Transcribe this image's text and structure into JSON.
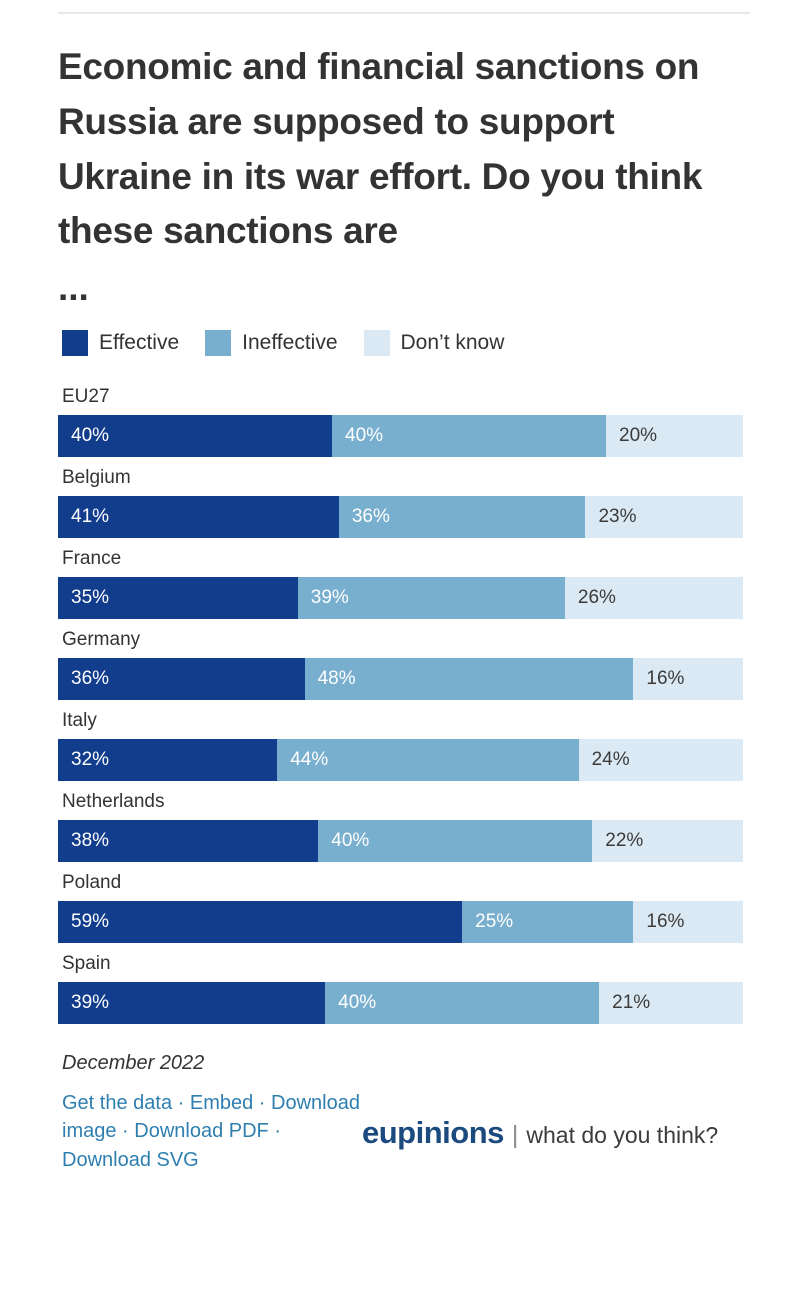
{
  "chart_data": {
    "type": "bar",
    "subtype": "stacked-horizontal-100",
    "title": "Economic and financial sanctions on Russia are supposed to support Ukraine in its war effort. Do you think these sanctions are",
    "title_ellipsis": "...",
    "xlabel": "",
    "ylabel": "",
    "unit": "%",
    "xlim": [
      0,
      100
    ],
    "grid": false,
    "legend_position": "top-left",
    "categories": [
      "EU27",
      "Belgium",
      "France",
      "Germany",
      "Italy",
      "Netherlands",
      "Poland",
      "Spain"
    ],
    "series": [
      {
        "name": "Effective",
        "color": "#123c8c",
        "values": [
          40,
          41,
          35,
          36,
          32,
          38,
          59,
          39
        ]
      },
      {
        "name": "Ineffective",
        "color": "#79afce",
        "values": [
          40,
          36,
          39,
          48,
          44,
          40,
          25,
          40
        ]
      },
      {
        "name": "Don't know",
        "color": "#dbe9f4",
        "values": [
          20,
          23,
          26,
          16,
          24,
          22,
          16,
          21
        ]
      }
    ],
    "rows": [
      {
        "label": "EU27",
        "segments": [
          {
            "series": "Effective",
            "value": 40,
            "text": "40%"
          },
          {
            "series": "Ineffective",
            "value": 40,
            "text": "40%"
          },
          {
            "series": "Don't know",
            "value": 20,
            "text": "20%"
          }
        ]
      },
      {
        "label": "Belgium",
        "segments": [
          {
            "series": "Effective",
            "value": 41,
            "text": "41%"
          },
          {
            "series": "Ineffective",
            "value": 36,
            "text": "36%"
          },
          {
            "series": "Don't know",
            "value": 23,
            "text": "23%"
          }
        ]
      },
      {
        "label": "France",
        "segments": [
          {
            "series": "Effective",
            "value": 35,
            "text": "35%"
          },
          {
            "series": "Ineffective",
            "value": 39,
            "text": "39%"
          },
          {
            "series": "Don't know",
            "value": 26,
            "text": "26%"
          }
        ]
      },
      {
        "label": "Germany",
        "segments": [
          {
            "series": "Effective",
            "value": 36,
            "text": "36%"
          },
          {
            "series": "Ineffective",
            "value": 48,
            "text": "48%"
          },
          {
            "series": "Don't know",
            "value": 16,
            "text": "16%"
          }
        ]
      },
      {
        "label": "Italy",
        "segments": [
          {
            "series": "Effective",
            "value": 32,
            "text": "32%"
          },
          {
            "series": "Ineffective",
            "value": 44,
            "text": "44%"
          },
          {
            "series": "Don't know",
            "value": 24,
            "text": "24%"
          }
        ]
      },
      {
        "label": "Netherlands",
        "segments": [
          {
            "series": "Effective",
            "value": 38,
            "text": "38%"
          },
          {
            "series": "Ineffective",
            "value": 40,
            "text": "40%"
          },
          {
            "series": "Don't know",
            "value": 22,
            "text": "22%"
          }
        ]
      },
      {
        "label": "Poland",
        "segments": [
          {
            "series": "Effective",
            "value": 59,
            "text": "59%"
          },
          {
            "series": "Ineffective",
            "value": 25,
            "text": "25%"
          },
          {
            "series": "Don't know",
            "value": 16,
            "text": "16%"
          }
        ]
      },
      {
        "label": "Spain",
        "segments": [
          {
            "series": "Effective",
            "value": 39,
            "text": "39%"
          },
          {
            "series": "Ineffective",
            "value": 40,
            "text": "40%"
          },
          {
            "series": "Don't know",
            "value": 21,
            "text": "21%"
          }
        ]
      }
    ]
  },
  "legend": {
    "items": [
      {
        "label": "Effective",
        "color": "#123c8c"
      },
      {
        "label": "Ineffective",
        "color": "#79afce"
      },
      {
        "label": "Don’t know",
        "color": "#dbe9f4"
      }
    ]
  },
  "footer": {
    "date": "December 2022",
    "links": [
      {
        "label": "Get the data"
      },
      {
        "label": "Embed"
      },
      {
        "label": "Download image"
      },
      {
        "label": "Download PDF"
      },
      {
        "label": "Download SVG"
      }
    ],
    "separator": "·",
    "brand_name": "eupinions",
    "brand_divider": "|",
    "brand_tagline": "what do you think?"
  },
  "colors": {
    "effective": "#123c8c",
    "ineffective": "#79afce",
    "dont_know": "#dbe9f4",
    "link": "#2e7fb0",
    "brand": "#1b4a7e",
    "text": "#333333",
    "rule": "#e8e8e8"
  }
}
